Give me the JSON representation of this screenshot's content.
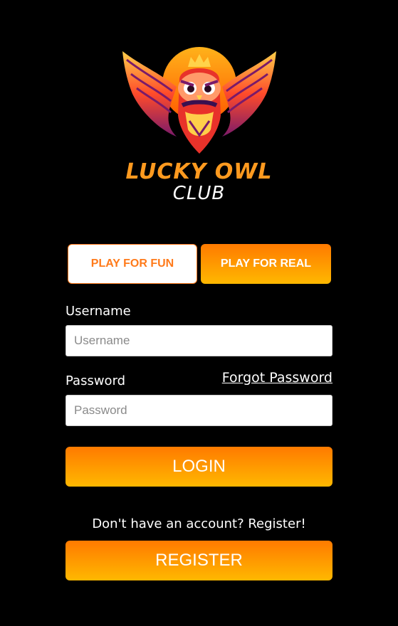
{
  "brand": {
    "title": "LUCKY OWL",
    "subtitle": "CLUB",
    "logo_icon": "owl-logo-icon"
  },
  "modes": {
    "fun_label": "PLAY FOR FUN",
    "real_label": "PLAY FOR REAL"
  },
  "form": {
    "username_label": "Username",
    "username_placeholder": "Username",
    "password_label": "Password",
    "password_placeholder": "Password",
    "forgot_label": "Forgot Password",
    "login_label": "LOGIN"
  },
  "register": {
    "prompt": "Don't have an account? Register!",
    "button_label": "REGISTER"
  },
  "colors": {
    "background": "#000000",
    "accent_orange": "#ff7a00",
    "accent_yellow": "#ffb800"
  }
}
